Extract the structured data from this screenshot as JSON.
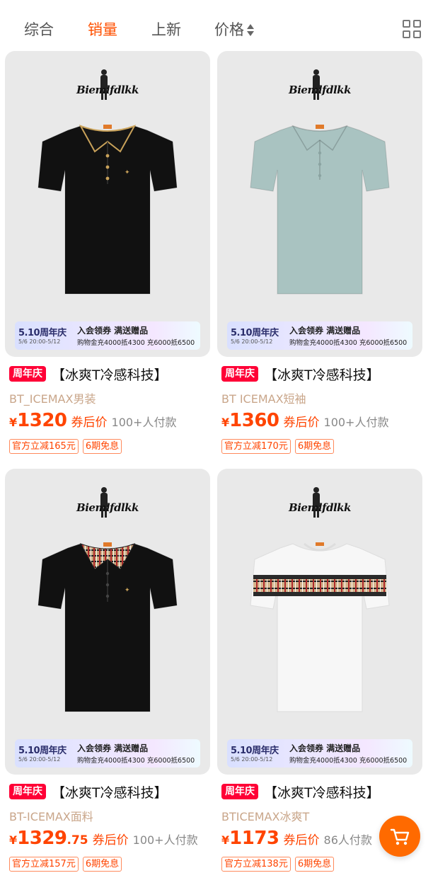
{
  "sort_bar": {
    "tabs": [
      {
        "label": "综合",
        "active": false
      },
      {
        "label": "销量",
        "active": true
      },
      {
        "label": "上新",
        "active": false
      },
      {
        "label": "价格",
        "active": false
      }
    ],
    "grid_icon": "grid-view-icon"
  },
  "colors": {
    "accent": "#ff5000",
    "price": "#ff4400",
    "tag_red": "#ff0036",
    "subtitle": "#c9a68a",
    "image_bg": "#e9e9e9"
  },
  "products": [
    {
      "brand": "Biemlfdlkk",
      "shirt_color": "#111111",
      "shirt_style": "polo-gold-tipped-collar",
      "promo": {
        "badge": "5.10周年庆",
        "badge_date": "5/6 20:00-5/12",
        "line1": "入会领券 满送赠品",
        "line2": "购物金充4000抵4300 充6000抵6500"
      },
      "tag": "周年庆",
      "title": "【冰爽T冷感科技】",
      "subtitle": "BT_ICEMAX男装",
      "currency": "¥",
      "price": "1320",
      "price_decimal": "",
      "after_coupon": "券后价",
      "buyers": "100+人付款",
      "chips": [
        "官方立减165元",
        "6期免息"
      ]
    },
    {
      "brand": "Biemlfdlkk",
      "shirt_color": "#a9c3c1",
      "shirt_style": "polo-plain",
      "promo": {
        "badge": "5.10周年庆",
        "badge_date": "5/6 20:00-5/12",
        "line1": "入会领券 满送赠品",
        "line2": "购物金充4000抵4300 充6000抵6500"
      },
      "tag": "周年庆",
      "title": "【冰爽T冷感科技】",
      "subtitle": "BT ICEMAX短袖",
      "currency": "¥",
      "price": "1360",
      "price_decimal": "",
      "after_coupon": "券后价",
      "buyers": "100+人付款",
      "chips": [
        "官方立减170元",
        "6期免息"
      ]
    },
    {
      "brand": "Biemlfdlkk",
      "shirt_color": "#111111",
      "shirt_style": "polo-check-collar",
      "promo": {
        "badge": "5.10周年庆",
        "badge_date": "5/6 20:00-5/12",
        "line1": "入会领券 满送赠品",
        "line2": "购物金充4000抵4300 充6000抵6500"
      },
      "tag": "周年庆",
      "title": "【冰爽T冷感科技】",
      "subtitle": "BT-ICEMAX面料",
      "currency": "¥",
      "price": "1329",
      "price_decimal": ".75",
      "after_coupon": "券后价",
      "buyers": "100+人付款",
      "chips": [
        "官方立减157元",
        "6期免息"
      ]
    },
    {
      "brand": "Biemlfdlkk",
      "shirt_color": "#f7f7f7",
      "shirt_style": "tee-check-stripe",
      "promo": {
        "badge": "5.10周年庆",
        "badge_date": "5/6 20:00-5/12",
        "line1": "入会领券 满送赠品",
        "line2": "购物金充4000抵4300 充6000抵6500"
      },
      "tag": "周年庆",
      "title": "【冰爽T冷感科技】",
      "subtitle": "BTICEMAX冰爽T",
      "currency": "¥",
      "price": "1173",
      "price_decimal": "",
      "after_coupon": "券后价",
      "buyers": "86人付款",
      "chips": [
        "官方立减138元",
        "6期免息"
      ]
    }
  ],
  "cart_button": {
    "icon": "shopping-cart-icon"
  }
}
